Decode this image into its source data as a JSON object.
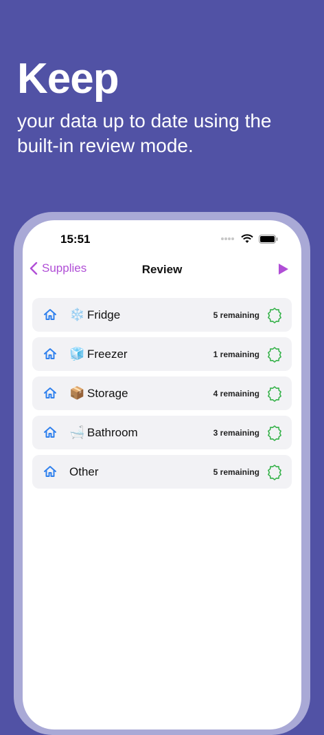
{
  "promo": {
    "headline": "Keep",
    "subline": "your data up to date using the built-in review mode."
  },
  "status_bar": {
    "time": "15:51"
  },
  "nav": {
    "back_label": "Supplies",
    "title": "Review"
  },
  "colors": {
    "background": "#5152A5",
    "accent": "#B04ED6",
    "home_icon": "#2F80ED",
    "check_badge": "#36B24A"
  },
  "rows": [
    {
      "emoji": "❄️",
      "name": "Fridge",
      "remaining": "5 remaining",
      "icon": "home-icon"
    },
    {
      "emoji": "🧊",
      "name": "Freezer",
      "remaining": "1 remaining",
      "icon": "home-icon"
    },
    {
      "emoji": "📦",
      "name": "Storage",
      "remaining": "4 remaining",
      "icon": "home-icon"
    },
    {
      "emoji": "🛁",
      "name": "Bathroom",
      "remaining": "3 remaining",
      "icon": "home-icon"
    },
    {
      "emoji": "",
      "name": "Other",
      "remaining": "5 remaining",
      "icon": "home-icon"
    }
  ]
}
